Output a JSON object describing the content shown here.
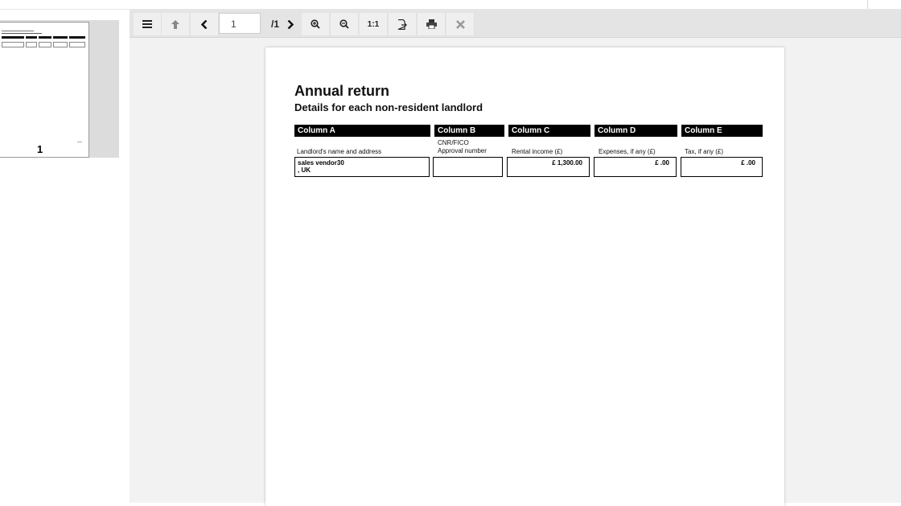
{
  "thumbnail": {
    "page_number": "1"
  },
  "toolbar": {
    "menu_icon": "menu-icon",
    "current_page": "1",
    "page_count": "/1"
  },
  "document": {
    "title": "Annual return",
    "subtitle": "Details for each non-resident landlord",
    "columns": [
      {
        "header": "Column A",
        "label": "Landlord's name and address",
        "value_line1": "sales vendor30",
        "value_line2": ", UK"
      },
      {
        "header": "Column B",
        "label_line1": "CNR/FICO",
        "label_line2": "Approval number",
        "value": ""
      },
      {
        "header": "Column C",
        "label": "Rental income (£)",
        "value": "£ 1,300.00"
      },
      {
        "header": "Column D",
        "label": "Expenses, if any (£)",
        "value": "£ .00"
      },
      {
        "header": "Column E",
        "label": "Tax, if any (£)",
        "value": "£ .00"
      }
    ]
  }
}
